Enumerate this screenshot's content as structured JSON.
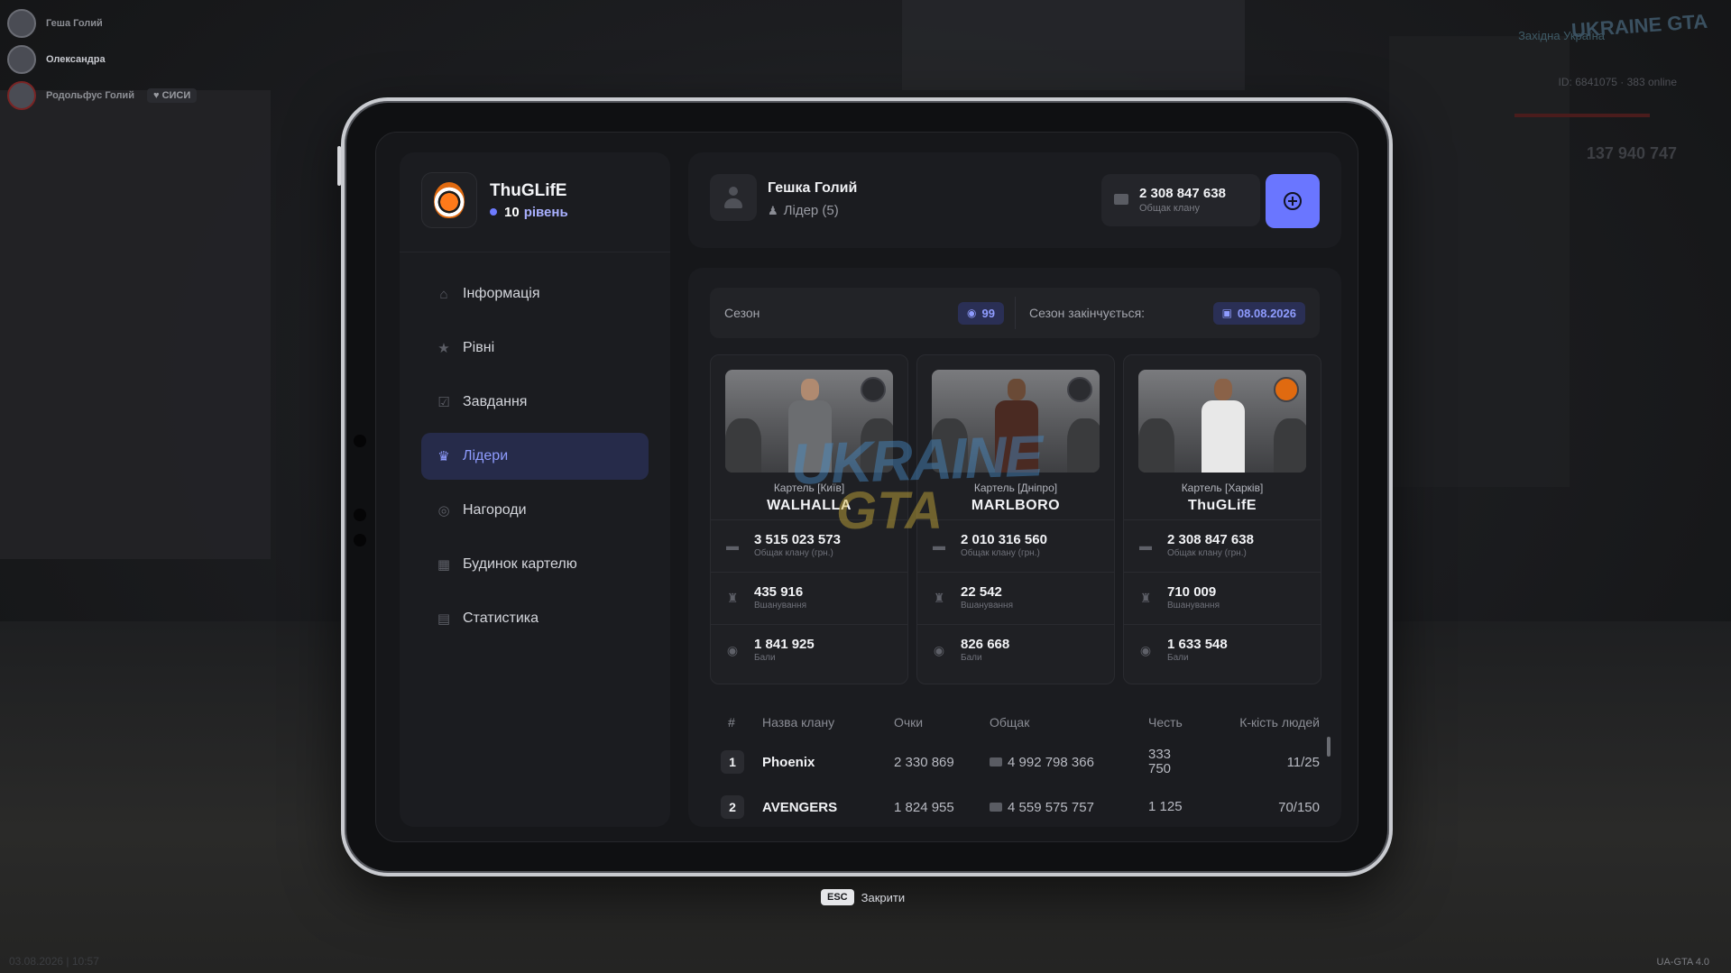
{
  "players": [
    {
      "name": "Геша Голий",
      "tag": ""
    },
    {
      "name": "Олександра",
      "tag": ""
    },
    {
      "name": "Родольфус Голий",
      "tag": "СИСИ"
    }
  ],
  "hud": {
    "region": "Західна Україна",
    "id_line": "ID: 6841075",
    "online": "383 online",
    "money": "137 940 747",
    "logo": "UKRAINE GTA",
    "date_time": "03.08.2026 | 10:57",
    "version": "UA-GTA 4.0"
  },
  "clan": {
    "name": "ThuGLifE",
    "level_number": "10",
    "level_word": "рівень"
  },
  "nav": [
    {
      "label": "Інформація",
      "icon": "home-icon",
      "glyph": "⌂",
      "active": false
    },
    {
      "label": "Рівні",
      "icon": "star-icon",
      "glyph": "★",
      "active": false
    },
    {
      "label": "Завдання",
      "icon": "checkbox-icon",
      "glyph": "☑",
      "active": false
    },
    {
      "label": "Лідери",
      "icon": "crown-icon",
      "glyph": "♛",
      "active": true
    },
    {
      "label": "Нагороди",
      "icon": "medal-icon",
      "glyph": "◎",
      "active": false
    },
    {
      "label": "Будинок картелю",
      "icon": "chart-icon",
      "glyph": "▦",
      "active": false
    },
    {
      "label": "Статистика",
      "icon": "store-icon",
      "glyph": "▤",
      "active": false
    }
  ],
  "user": {
    "name": "Гешка Голий",
    "role": "Лідер (5)"
  },
  "treasury": {
    "value": "2 308 847 638",
    "label": "Общак клану"
  },
  "season": {
    "label": "Сезон",
    "number": "99",
    "ends_label": "Сезон закінчується:",
    "ends_date": "08.08.2026"
  },
  "leaders": [
    {
      "cartel": "Картель [Київ]",
      "name": "WALHALLA",
      "treasury": "3 515 023 573",
      "treasury_label": "Общак клану (грн.)",
      "honor": "435 916",
      "honor_label": "Вшанування",
      "points": "1 841 925",
      "points_label": "Бали",
      "shirt_color": "#6b6d70"
    },
    {
      "cartel": "Картель [Дніпро]",
      "name": "MARLBORO",
      "treasury": "2 010 316 560",
      "treasury_label": "Общак клану (грн.)",
      "honor": "22 542",
      "honor_label": "Вшанування",
      "points": "826 668",
      "points_label": "Бали",
      "shirt_color": "#4a2a22"
    },
    {
      "cartel": "Картель [Харків]",
      "name": "ThuGLifE",
      "treasury": "2 308 847 638",
      "treasury_label": "Общак клану (грн.)",
      "honor": "710 009",
      "honor_label": "Вшанування",
      "points": "1 633 548",
      "points_label": "Бали",
      "shirt_color": "#e8e8e8"
    }
  ],
  "watermark": {
    "line1": "UKRAINE",
    "line2": "GTA"
  },
  "table": {
    "headers": {
      "rank": "#",
      "name": "Назва клану",
      "points": "Очки",
      "treasury": "Общак",
      "honor": "Честь",
      "people": "К-кість людей"
    },
    "rows": [
      {
        "rank": "1",
        "name": "Phoenix",
        "points": "2 330 869",
        "treasury": "4 992 798 366",
        "honor_1": "333",
        "honor_2": "750",
        "people": "11/25"
      },
      {
        "rank": "2",
        "name": "AVENGERS",
        "points": "1 824 955",
        "treasury": "4 559 575 757",
        "honor_1": "1 125",
        "honor_2": "",
        "people": "70/150"
      }
    ]
  },
  "esc": {
    "key": "ESC",
    "label": "Закрити"
  }
}
